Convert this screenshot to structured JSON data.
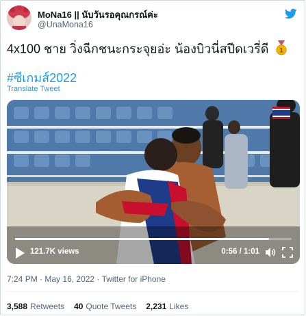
{
  "author": {
    "display_name": "MoNa16 || นับวันรอคุณกรณ์ค่ะ",
    "handle": "@UnaMona16"
  },
  "tweet": {
    "text": "4x100 ชาย วิ่งฉีกชนะกระจุยอ่ะ น้องบิวนี่สปีดเวรี่ดี",
    "medal_emoji": "🥇",
    "hashtag": "#ซีเกมส์2022",
    "translate_label": "Translate Tweet"
  },
  "video": {
    "views": "121.7K views",
    "timestamp": "0:56 / 1:01",
    "progress": 0.918
  },
  "meta": {
    "time": "7:24 PM",
    "date": "May 16, 2022",
    "source": "Twitter for iPhone",
    "separator": "·"
  },
  "stats": {
    "retweets_count": "3,588",
    "retweets_label": "Retweets",
    "quotes_count": "40",
    "quotes_label": "Quote Tweets",
    "likes_count": "2,231",
    "likes_label": "Likes"
  },
  "icons": {
    "brand": "twitter-bird-icon",
    "play": "play-icon",
    "volume": "volume-icon",
    "fullscreen": "fullscreen-icon"
  },
  "colors": {
    "link": "#1d9bf0",
    "text": "#0f1419",
    "secondary": "#536471"
  }
}
